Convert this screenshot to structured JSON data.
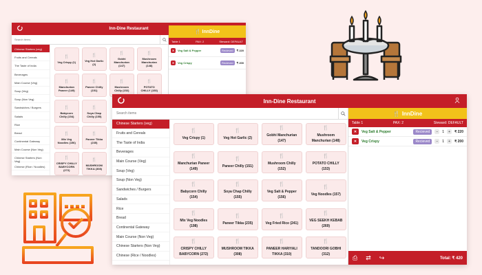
{
  "app_title": "Inn-Dine Restaurant",
  "brand": "InnDine",
  "search": {
    "placeholder": "Search items"
  },
  "categories_back": [
    "Chinese Starters (veg)",
    "Fruits and Cereals",
    "The Taste of India",
    "Beverages",
    "Main Course (Veg)",
    "Soup (Veg)",
    "Soup (Non Veg)",
    "Sandwiches / Burgers",
    "Salads",
    "Rice",
    "Bread",
    "Continental Gateway",
    "Main Course (Non Veg)",
    "Chinese Starters (Non Veg)",
    "Chinese (Rice / Noodles)"
  ],
  "categories_front": [
    "Chinese Starters (veg)",
    "Fruits and Cereals",
    "The Taste of India",
    "Beverages",
    "Main Course (Veg)",
    "Soup (Veg)",
    "Soup (Non Veg)",
    "Sandwiches / Burgers",
    "Salads",
    "Rice",
    "Bread",
    "Continental Gateway",
    "Main Course (Non Veg)",
    "Chinese Starters (Non Veg)",
    "Chinese (Rice / Noodles)"
  ],
  "items_back": [
    "Veg Crispy (1)",
    "Veg Hot Garlic (2)",
    "Gobhi Manchurian (147)",
    "Mushroom Manchurian (148)",
    "Manchurian Paneer (149)",
    "Paneer Chilly (151)",
    "Mushroom Chilly (152)",
    "POTATO CHILLY (153)",
    "Babycorn Chilly (154)",
    "Soya Chap Chilly (155)",
    "",
    "",
    "Mix Veg Noodles (156)",
    "Paneer Tikka (235)",
    "",
    "",
    "CRISPY CHILLY BABYCORN (272)",
    "MUSHROOM TIKKA (308)",
    "",
    ""
  ],
  "items_front": [
    "Veg Crispy (1)",
    "Veg Hot Garlic (2)",
    "Gobhi Manchurian (147)",
    "Mushroom Manchurian (148)",
    "Manchurian Paneer (149)",
    "Paneer Chilly (151)",
    "Mushroom Chilly (152)",
    "POTATO CHILLY (153)",
    "Babycorn Chilly (154)",
    "Soya Chap Chilly (155)",
    "Veg Salt & Pepper (156)",
    "Veg Noodles (157)",
    "Mix Veg Noodles (198)",
    "Paneer Tikka (235)",
    "Veg Fried Rice (241)",
    "VEG SEEKH KEBAB (269)",
    "CRISPY CHILLY BABYCORN (272)",
    "MUSHROOM TIKKA (308)",
    "PANEER HARIYALI TIKKA (310)",
    "TANDOORI GOBHI (312)"
  ],
  "order_back": {
    "table": "Table 1",
    "pax": "PAX: 2",
    "steward": "Steward: DEFAULT",
    "rows": [
      {
        "name": "Veg Salt & Pepper",
        "status": "Recieved",
        "price": "₹ 220"
      },
      {
        "name": "Veg Crispy",
        "status": "Recieved",
        "price": "₹ 200"
      }
    ]
  },
  "order_front": {
    "table": "Table 1",
    "pax": "PAX: 2",
    "steward": "Steward: DEFAULT",
    "rows": [
      {
        "name": "Veg Salt & Pepper",
        "status": "Recieved",
        "qty": "1",
        "price": "₹ 220"
      },
      {
        "name": "Veg Crispy",
        "status": "Recieved",
        "qty": "1",
        "price": "₹ 200"
      }
    ],
    "total": "Total: ₹ 420"
  },
  "colors": {
    "primary": "#c41e28",
    "accent": "#f2c21a",
    "badge": "#9b88c9",
    "background": "#fdeeed"
  }
}
